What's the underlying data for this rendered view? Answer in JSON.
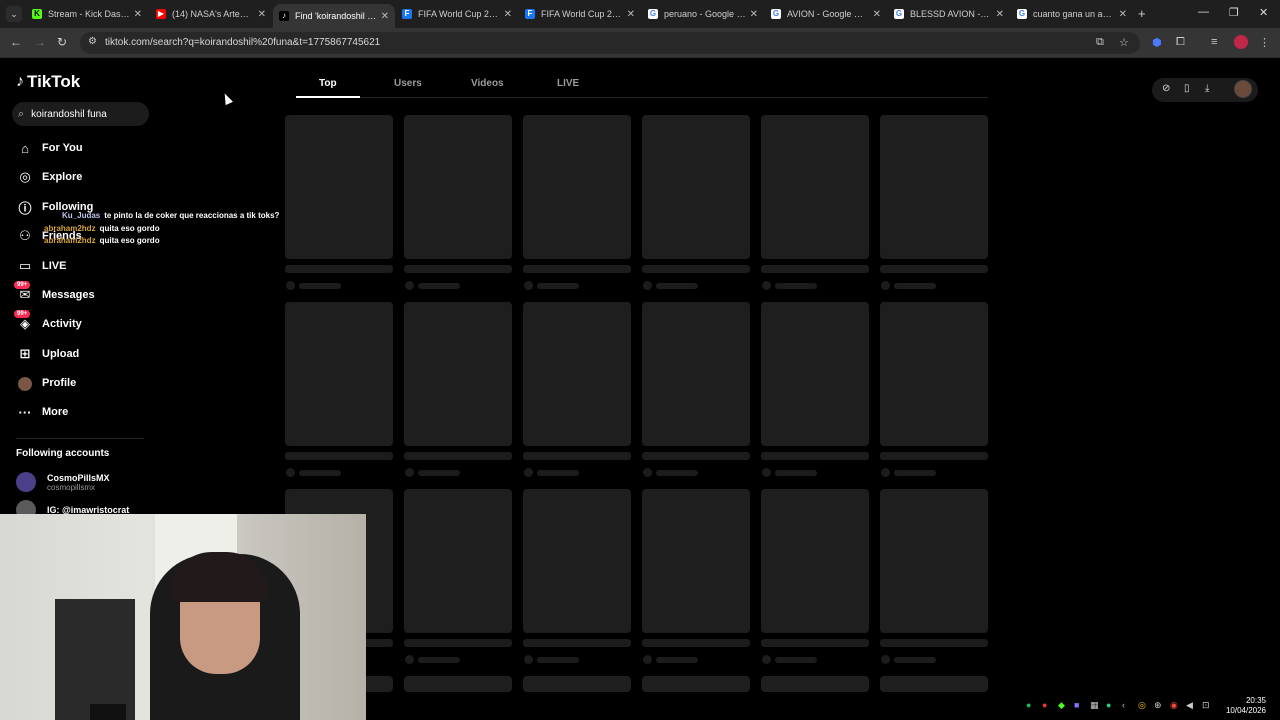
{
  "browser": {
    "tabs": [
      {
        "title": "Stream - Kick Dashbo",
        "favicon": "kick-icon",
        "color": "#53fc18",
        "active": false
      },
      {
        "title": "(14) NASA's Artemis I",
        "favicon": "youtube-icon",
        "color": "#ff0000",
        "active": false
      },
      {
        "title": "Find 'koirandoshil fun",
        "favicon": "tiktok-icon",
        "color": "#ffffff",
        "active": true
      },
      {
        "title": "FIFA World Cup 2026",
        "favicon": "facebook-icon",
        "color": "#1877f2",
        "active": false
      },
      {
        "title": "FIFA World Cup 2026",
        "favicon": "facebook-icon",
        "color": "#1877f2",
        "active": false
      },
      {
        "title": "peruano - Google Se",
        "favicon": "google-icon",
        "color": "#ffffff",
        "active": false
      },
      {
        "title": "AVION - Google Sear",
        "favicon": "google-icon",
        "color": "#ffffff",
        "active": false
      },
      {
        "title": "BLESSD AVION - Goo",
        "favicon": "google-icon",
        "color": "#ffffff",
        "active": false
      },
      {
        "title": "cuanto gana un adm",
        "favicon": "google-icon",
        "color": "#ffffff",
        "active": false
      }
    ],
    "url": "tiktok.com/search?q=koirandoshil%20funa&t=1775867745621"
  },
  "tiktok": {
    "logo": "TikTok",
    "search": {
      "value": "koirandoshil funa"
    },
    "nav": [
      {
        "label": "For You",
        "icon": "home-icon"
      },
      {
        "label": "Explore",
        "icon": "compass-icon"
      },
      {
        "label": "Following",
        "icon": "following-icon"
      },
      {
        "label": "Friends",
        "icon": "friends-icon"
      },
      {
        "label": "LIVE",
        "icon": "live-icon"
      },
      {
        "label": "Messages",
        "icon": "messages-icon",
        "badge": "99+"
      },
      {
        "label": "Activity",
        "icon": "activity-icon",
        "badge": "99+"
      },
      {
        "label": "Upload",
        "icon": "upload-icon"
      },
      {
        "label": "Profile",
        "icon": "profile-avatar"
      },
      {
        "label": "More",
        "icon": "more-icon"
      }
    ],
    "following_heading": "Following accounts",
    "following_accounts": [
      {
        "name": "CosmoPillsMX",
        "handle": "cosmopillsmx"
      },
      {
        "name": "IG: @imawristocrat",
        "handle": ""
      }
    ],
    "result_tabs": [
      "Top",
      "Users",
      "Videos",
      "LIVE"
    ],
    "active_tab": "Top"
  },
  "chat": [
    {
      "user": "Ku_Judas",
      "message": "te pinto la de coker que reaccionas a tik toks?"
    },
    {
      "user": "abraham2hdz",
      "message": "quita eso gordo"
    },
    {
      "user": "abraham2hdz",
      "message": "quita eso gordo"
    }
  ],
  "taskbar": {
    "time": "20:35",
    "date": "10/04/2026"
  },
  "colors": {
    "accent": "#fe2c55",
    "chat_username": "#d6a33e",
    "skeleton": "#1e1e1e"
  }
}
